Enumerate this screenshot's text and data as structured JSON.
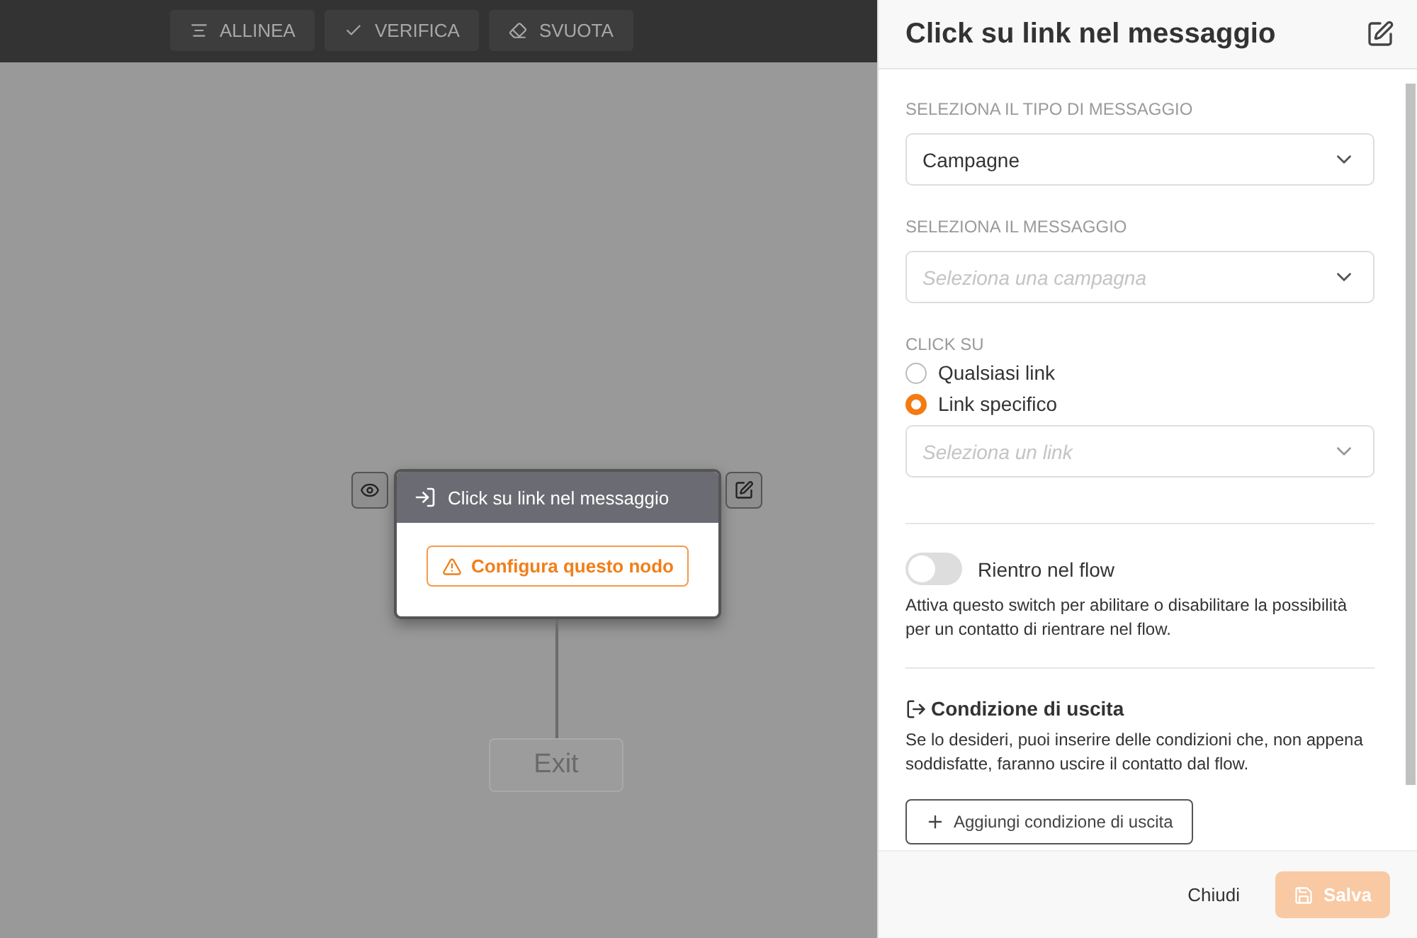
{
  "toolbar": [
    {
      "label": "ALLINEA",
      "kind": "align"
    },
    {
      "label": "VERIFICA",
      "kind": "check"
    },
    {
      "label": "SVUOTA",
      "kind": "erase"
    }
  ],
  "node": {
    "title": "Click su link nel messaggio",
    "warning": "Configura questo nodo"
  },
  "exit_node": {
    "label": "Exit",
    "disabled": true
  },
  "panel": {
    "title": "Click su link nel messaggio",
    "message_type": {
      "label": "SELEZIONA IL TIPO DI MESSAGGIO",
      "value": "Campagne"
    },
    "message": {
      "label": "SELEZIONA IL MESSAGGIO",
      "placeholder": "Seleziona una campagna"
    },
    "click": {
      "label": "CLICK SU",
      "options": [
        {
          "label": "Qualsiasi link",
          "selected": false
        },
        {
          "label": "Link specifico",
          "selected": true
        }
      ],
      "link_placeholder": "Seleziona un link"
    },
    "reentry": {
      "label": "Rientro nel flow",
      "on": false,
      "help": "Attiva questo switch per abilitare o disabilitare la possibilità per un contatto di rientrare nel flow."
    },
    "exit_condition": {
      "title": "Condizione di uscita",
      "help": "Se lo desideri, puoi inserire delle condizioni che, non appena soddisfatte, faranno uscire il contatto dal flow.",
      "button": "Aggiungi condizione di uscita"
    },
    "footer": {
      "close": "Chiudi",
      "save": "Salva",
      "save_disabled": true
    }
  }
}
